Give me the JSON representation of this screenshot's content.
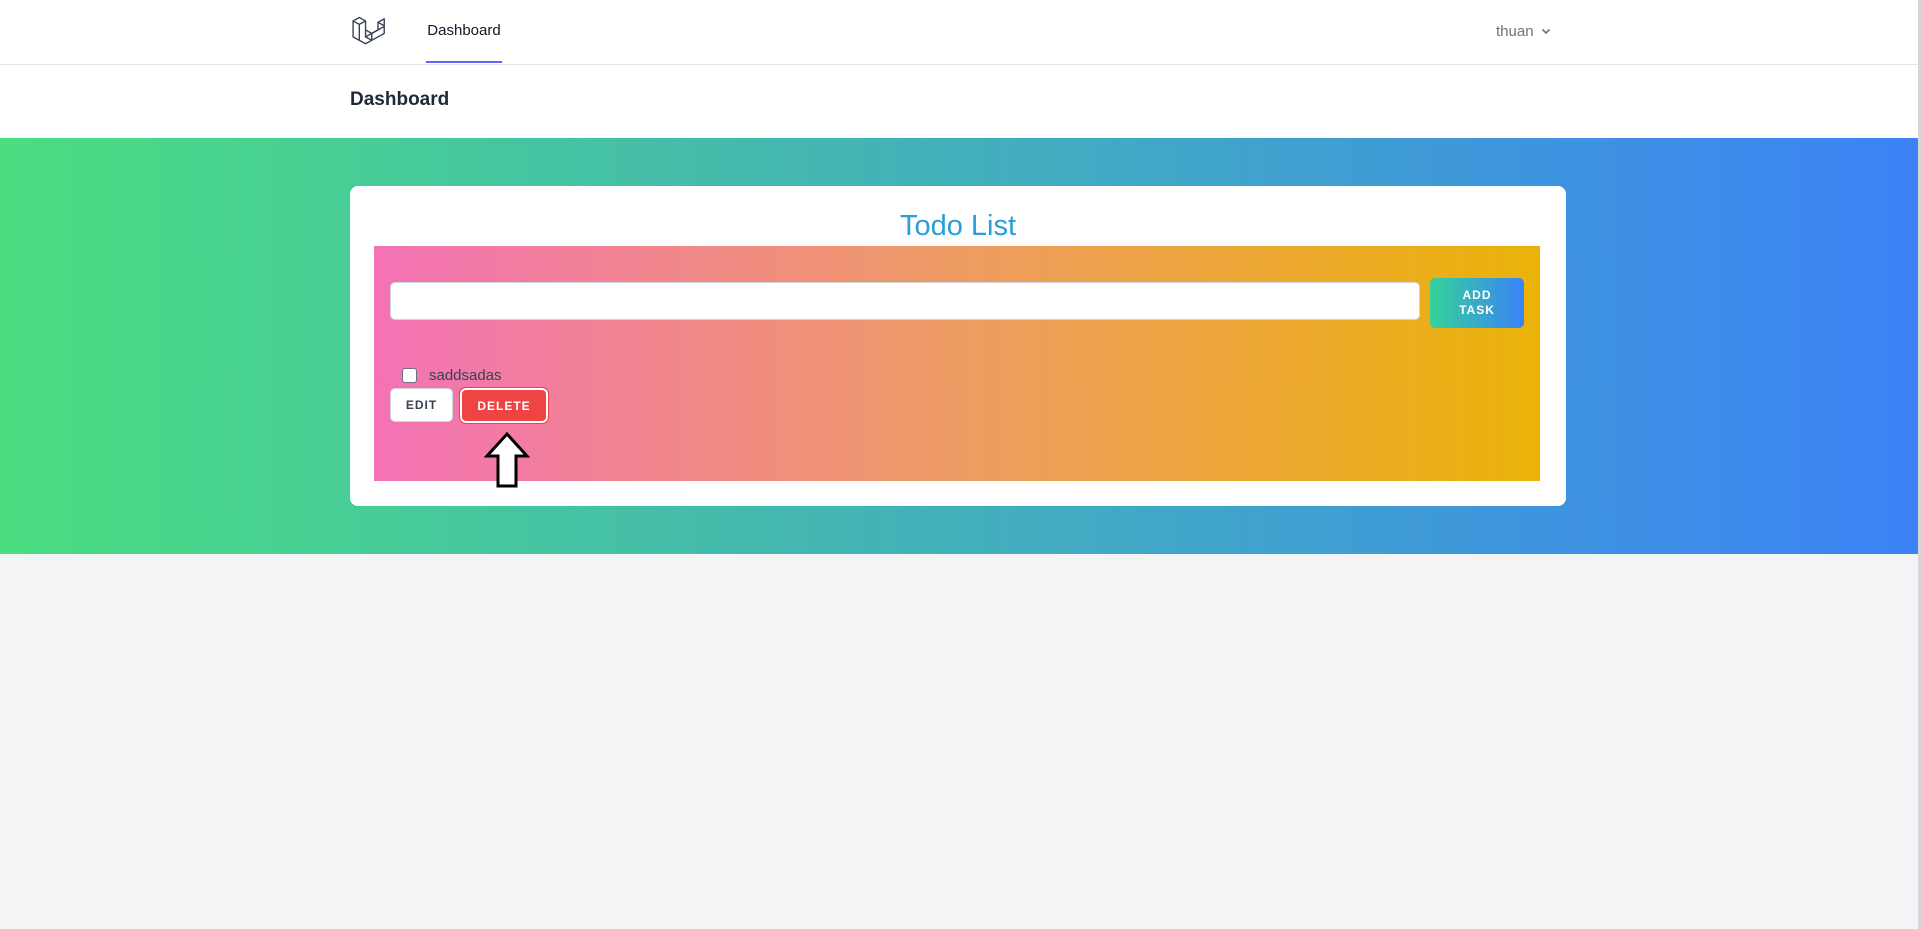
{
  "nav": {
    "logo_icon": "laravel-logo-icon",
    "dashboard_link": "Dashboard",
    "user_name": "thuan",
    "user_chevron_icon": "chevron-down-icon",
    "active_underline_color": "#6366f1"
  },
  "header": {
    "title": "Dashboard"
  },
  "todo": {
    "title": "Todo List",
    "input_value": "",
    "add_button_label": "ADD TASK",
    "tasks": [
      {
        "text": "saddsadas",
        "checked": false,
        "edit_label": "EDIT",
        "delete_label": "DELETE"
      }
    ]
  },
  "annotation": {
    "pointer_icon": "up-arrow-icon"
  },
  "colors": {
    "band_start": "#4ade80",
    "band_end": "#3b82f6",
    "panel_start": "#f472b6",
    "panel_end": "#eab308",
    "title": "#2a9ddb",
    "delete": "#ef4444"
  }
}
